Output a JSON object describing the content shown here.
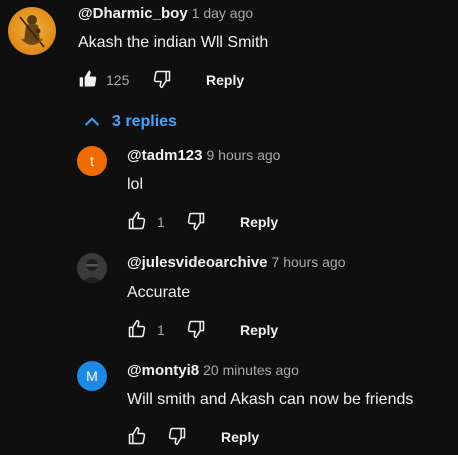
{
  "comment": {
    "author": "@Dharmic_boy",
    "time": "1 day ago",
    "text": "Akash the indian Wll Smith",
    "likes": "125",
    "reply_label": "Reply"
  },
  "replies_toggle": {
    "label": "3 replies"
  },
  "replies": [
    {
      "author": "@tadm123",
      "time": "9 hours ago",
      "text": "lol",
      "likes": "1",
      "reply_label": "Reply",
      "avatar_letter": "t",
      "avatar_color": "#ef6c00"
    },
    {
      "author": "@julesvideoarchive",
      "time": "7 hours ago",
      "text": "Accurate",
      "likes": "1",
      "reply_label": "Reply"
    },
    {
      "author": "@montyi8",
      "time": "20 minutes ago",
      "text": "Will smith and Akash can now be friends",
      "likes": "",
      "reply_label": "Reply",
      "avatar_letter": "M",
      "avatar_color": "#1e88e5"
    }
  ],
  "colors": {
    "background": "#0f0f0f",
    "link_blue": "#3ea6ff",
    "secondary_text": "#aaaaaa"
  }
}
